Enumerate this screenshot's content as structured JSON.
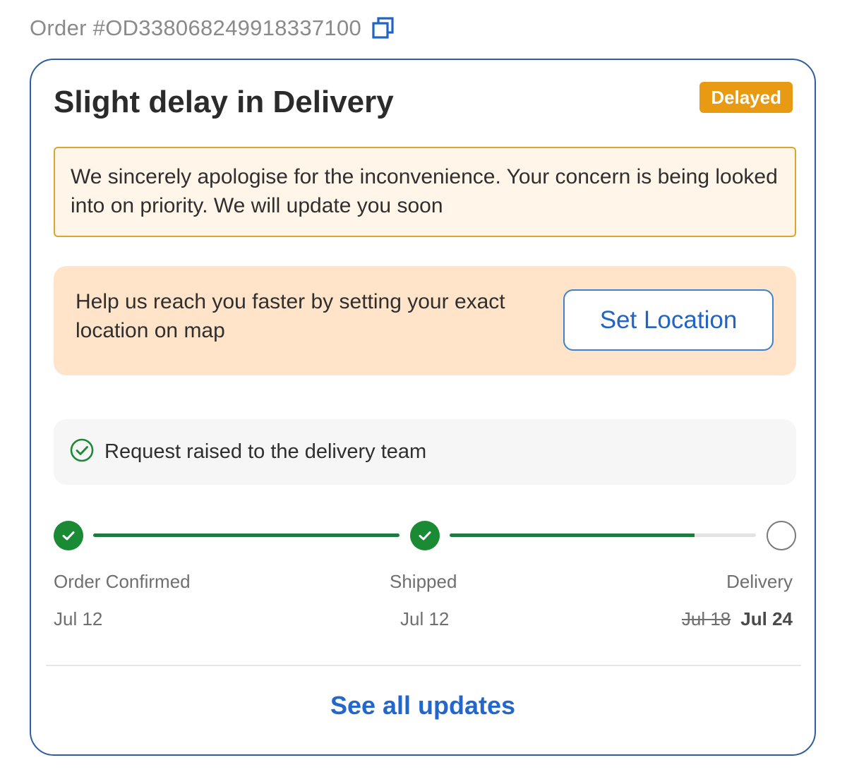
{
  "order": {
    "id_text": "Order #OD338068249918337100",
    "copy_icon": "copy-icon"
  },
  "card": {
    "title": "Slight delay in Delivery",
    "badge": "Delayed",
    "apology": "We sincerely apologise for the inconvenience. Your concern is being looked into on priority. We will update you soon",
    "location_prompt": "Help us reach you faster by setting your exact location on map",
    "set_location_label": "Set Location",
    "request_status": "Request raised to the delivery team",
    "request_icon": "check-circle-icon",
    "see_all_label": "See all updates"
  },
  "tracker": {
    "steps": [
      {
        "label": "Order Confirmed",
        "date": "Jul 12",
        "status": "done"
      },
      {
        "label": "Shipped",
        "date": "Jul 12",
        "status": "done"
      },
      {
        "label": "Delivery",
        "old_date": "Jul 18",
        "date": "Jul 24",
        "status": "pending"
      }
    ],
    "progress": [
      1.0,
      0.8
    ]
  },
  "colors": {
    "accent_blue": "#2164c4",
    "card_border": "#2f5e9e",
    "badge_orange": "#e89a12",
    "success_green": "#1b8a34",
    "apology_bg": "#fff6e9",
    "location_bg": "#ffe4c9"
  }
}
